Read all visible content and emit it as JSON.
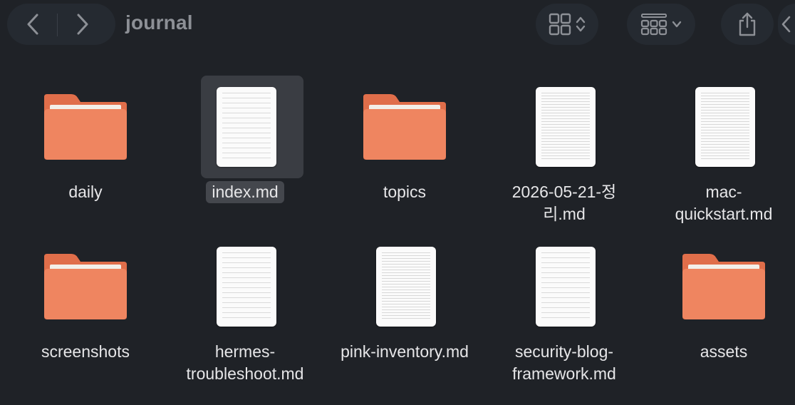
{
  "window": {
    "title": "journal"
  },
  "toolbar": {
    "back_icon": "chevron-left-icon",
    "forward_icon": "chevron-right-icon",
    "view_icon": "icon-grid-icon",
    "group_icon": "group-list-icon",
    "share_icon": "share-icon"
  },
  "colors": {
    "background": "#1f2227",
    "folder": "#ef8560",
    "folder_dark": "#e06e4a",
    "selection": "#3a3d43"
  },
  "items": [
    {
      "type": "folder",
      "name_lines": [
        "daily"
      ]
    },
    {
      "type": "document",
      "name_lines": [
        "index.md"
      ],
      "selected": true
    },
    {
      "type": "folder",
      "name_lines": [
        "topics"
      ]
    },
    {
      "type": "document",
      "name_lines": [
        "2026-05-21-정",
        "리.md"
      ]
    },
    {
      "type": "document",
      "name_lines": [
        "mac-",
        "quickstart.md"
      ]
    },
    {
      "type": "folder",
      "name_lines": [
        "screenshots"
      ]
    },
    {
      "type": "document",
      "name_lines": [
        "hermes-",
        "troubleshoot.md"
      ]
    },
    {
      "type": "document",
      "name_lines": [
        "pink-inventory.md"
      ]
    },
    {
      "type": "document",
      "name_lines": [
        "security-blog-",
        "framework.md"
      ]
    },
    {
      "type": "folder",
      "name_lines": [
        "assets"
      ]
    }
  ]
}
